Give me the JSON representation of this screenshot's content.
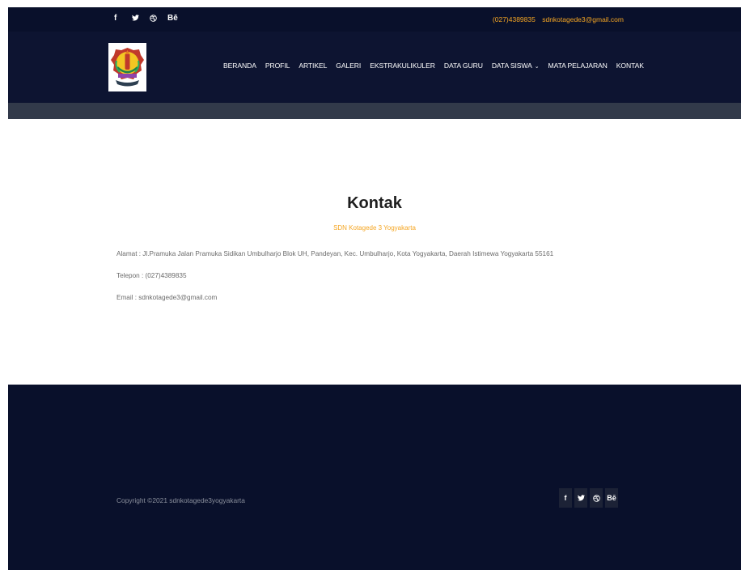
{
  "topbar": {
    "social": [
      {
        "icon": "facebook-icon",
        "glyph": "f"
      },
      {
        "icon": "twitter-icon",
        "glyph": "🐦"
      },
      {
        "icon": "dribbble-icon",
        "glyph": "⊛"
      },
      {
        "icon": "behance-icon",
        "glyph": "Bē"
      }
    ],
    "phone": "(027)4389835",
    "email": "sdnkotagede3@gmail.com"
  },
  "nav": {
    "items": [
      "BERANDA",
      "PROFIL",
      "ARTIKEL",
      "GALERI",
      "EKSTRAKULIKULER",
      "DATA GURU",
      "DATA SISWA",
      "MATA PELAJARAN",
      "KONTAK"
    ],
    "dropdown_caret": "⌄"
  },
  "content": {
    "title": "Kontak",
    "subtitle": "SDN Kotagede 3 Yogyakarta",
    "address": "Alamat : Jl.Pramuka Jalan Pramuka Sidikan Umbulharjo Blok UH, Pandeyan, Kec. Umbulharjo, Kota Yogyakarta, Daerah Istimewa Yogyakarta 55161",
    "phone": "Telepon : (027)4389835",
    "email": "Email : sdnkotagede3@gmail.com"
  },
  "footer": {
    "copyright": "Copyright ©2021 sdnkotagede3yogyakarta"
  },
  "colors": {
    "dark_navy": "#09102b",
    "header_navy": "#0d1431",
    "subbar_gray": "#323a4a",
    "accent_orange": "#f5a623"
  }
}
